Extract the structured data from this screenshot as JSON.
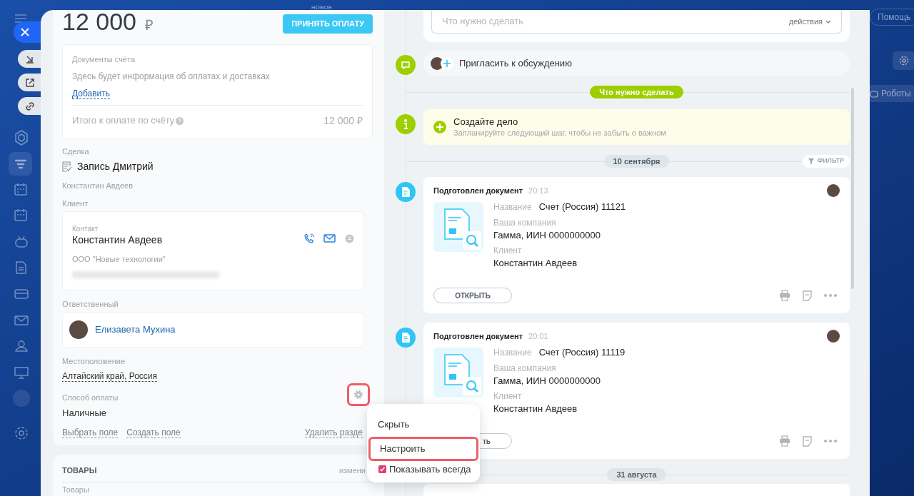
{
  "background": {
    "badge": "НОВОЕ",
    "help_button": "Помощь",
    "robots_button": "Роботы"
  },
  "payment": {
    "amount": "12 000",
    "currency": "₽",
    "accept_button": "ПРИНЯТЬ ОПЛАТУ"
  },
  "invoice_documents": {
    "title": "Документы счёта",
    "info": "Здесь будет информация об оплатах и доставках",
    "add_link": "Добавить",
    "total_label": "Итого к оплате по счёту",
    "total_value": "12 000 ₽"
  },
  "deal": {
    "label": "Сделка",
    "value": "Запись Дмитрий",
    "subtitle": "Константин Авдеев"
  },
  "client": {
    "label": "Клиент",
    "contact_label": "Контакт",
    "name": "Константин Авдеев",
    "company": "ООО \"Новые технологии\""
  },
  "responsible": {
    "label": "Ответственный",
    "name": "Елизавета Мухина"
  },
  "location": {
    "label": "Местоположение",
    "value": "Алтайский край, Россия"
  },
  "payment_method": {
    "label": "Способ оплаты",
    "value": "Наличные",
    "settings_highlighted": true
  },
  "section_links": [
    "Выбрать поле",
    "Создать поле"
  ],
  "delete_section_link": "Удалить разде",
  "products": {
    "title": "ТОВАРЫ",
    "edit_link": "измени",
    "label": "Товары"
  },
  "context_menu": [
    {
      "kind": "item",
      "label": "Скрыть",
      "highlighted": false
    },
    {
      "kind": "item",
      "label": "Настроить",
      "highlighted": true
    },
    {
      "kind": "checkbox",
      "label": "Показывать всегда",
      "checked": true
    }
  ],
  "timeline": {
    "todo_placeholder": "Что нужно сделать",
    "actions_button": "действия",
    "invite": "Пригласить к обсуждению",
    "stage_badge": "Что нужно сделать",
    "create_task": {
      "title": "Создайте дело",
      "hint": "Запланируйте следующий шаг, чтобы не забыть о важном"
    },
    "date": "10 сентября",
    "filter_button": "ФИЛЬТР",
    "documents": [
      {
        "title": "Подготовлен документ",
        "time": "20:13",
        "name_label": "Название",
        "name": "Счет (Россия) 11121",
        "company_label": "Ваша компания",
        "company": "Гамма, ИИН 0000000000",
        "client_label": "Клиент",
        "client": "Константин Авдеев",
        "open_button": "ОТКРЫТЬ"
      },
      {
        "title": "Подготовлен документ",
        "time": "20:01",
        "name_label": "Название",
        "name": "Счет (Россия) 11119",
        "company_label": "Ваша компания",
        "company": "Гамма, ИИН 0000000000",
        "client_label": "Клиент",
        "client": "Константин Авдеев",
        "open_button": "ть"
      }
    ],
    "next_date": "31 августа"
  }
}
